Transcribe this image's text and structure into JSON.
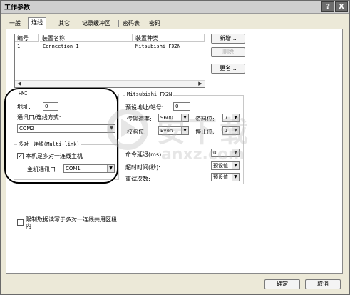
{
  "window": {
    "title": "工作参数",
    "help_btn": "?",
    "close_btn": "X"
  },
  "tabs": [
    {
      "label": "一般"
    },
    {
      "label": "连线"
    },
    {
      "label": "其它"
    },
    {
      "label": "记录缓冲区"
    },
    {
      "label": "密码表"
    },
    {
      "label": "密码"
    }
  ],
  "connections": {
    "headers": [
      "编号",
      "装置名称",
      "装置种类"
    ],
    "rows": [
      {
        "no": "1",
        "name": "Connection 1",
        "type": "Mitsubishi FX2N"
      }
    ]
  },
  "buttons": {
    "new": "新增...",
    "delete": "删除",
    "rename": "更名...",
    "ok": "确定",
    "cancel": "取消"
  },
  "hmi": {
    "legend": "HMI",
    "address_label": "地址:",
    "address_value": "0",
    "port_label": "通讯口/连线方式:",
    "port_value": "COM2"
  },
  "multilink": {
    "legend": "多对一连线(Multi-link)",
    "master_label": "本机是多对一连线主机",
    "master_checked": "✓",
    "host_port_label": "主机通讯口:",
    "host_port_value": "COM1"
  },
  "restrict": {
    "label": "限制数据读写于多对一连线共用区段内"
  },
  "device": {
    "legend": "Mitsubishi FX2N",
    "station_label": "预设地址/站号:",
    "station_value": "0",
    "baud_label": "传输速率:",
    "baud_value": "9600",
    "databits_label": "资料位:",
    "databits_value": "7",
    "parity_label": "校验位:",
    "parity_value": "Even",
    "stopbits_label": "停止位:",
    "stopbits_value": "1",
    "delay_label": "命令延迟(ms):",
    "delay_value": "0",
    "timeout_label": "超时时间(秒):",
    "timeout_value": "预设值",
    "retry_label": "重试次数:",
    "retry_value": "预设值"
  },
  "watermark": {
    "cn": "安下载",
    "en": "anxz.com"
  }
}
